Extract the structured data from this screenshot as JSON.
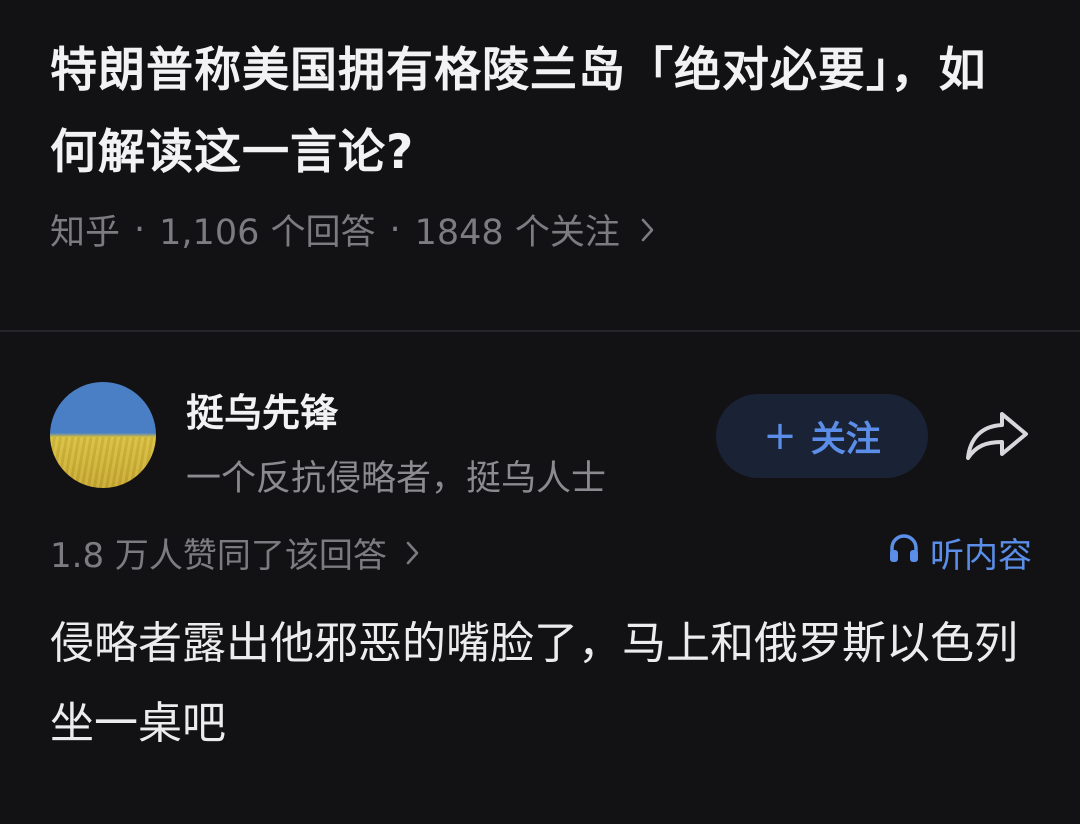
{
  "question": {
    "title": "特朗普称美国拥有格陵兰岛「绝对必要」，如何解读这一言论?",
    "source": "知乎",
    "answers_count": "1,106 个回答",
    "followers_count": "1848 个关注",
    "separator": "·"
  },
  "author": {
    "name": "挺乌先锋",
    "bio": "一个反抗侵略者，挺乌人士",
    "follow_label": "关注",
    "follow_plus": "+"
  },
  "answer": {
    "stats": "1.8 万人赞同了该回答",
    "listen_label": "听内容",
    "content": "侵略者露出他邪恶的嘴脸了，马上和俄罗斯以色列坐一桌吧"
  },
  "icons": {
    "meta_chevron": "chevron-right-icon",
    "share": "share-arrow-icon",
    "listen": "headphones-icon"
  },
  "colors": {
    "background": "#121214",
    "accent": "#5b8ee8",
    "muted_text": "#7b7b80"
  }
}
